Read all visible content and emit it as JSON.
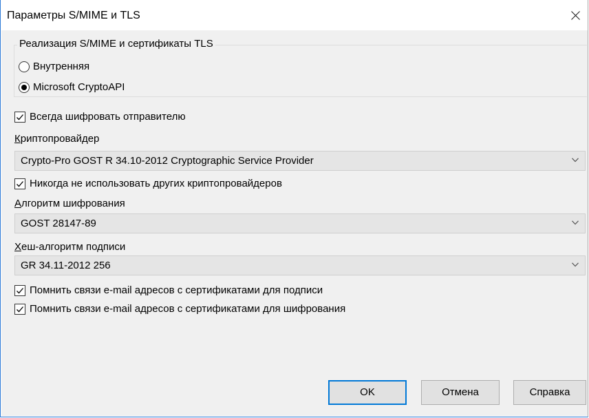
{
  "window": {
    "title": "Параметры S/MIME и TLS"
  },
  "group": {
    "caption": "Реализация S/MIME и сертификаты TLS",
    "options": [
      {
        "label": "Внутренняя",
        "checked": false
      },
      {
        "label": "Microsoft CryptoAPI",
        "checked": true
      }
    ]
  },
  "always_encrypt": {
    "label": "Всегда шифровать отправителю",
    "checked": true
  },
  "provider": {
    "label_mnemonic": "К",
    "label_rest": "риптопровайдер",
    "value": "Crypto-Pro GOST R 34.10-2012 Cryptographic Service Provider"
  },
  "never_other": {
    "label": "Никогда не использовать других криптопровайдеров",
    "checked": true
  },
  "encryption": {
    "label_mnemonic": "А",
    "label_rest": "лгоритм шифрования",
    "value": "GOST 28147-89"
  },
  "hash": {
    "label_mnemonic": "Х",
    "label_rest": "еш-алгоритм подписи",
    "value": "GR 34.11-2012 256"
  },
  "remember_sign": {
    "label": "Помнить связи e-mail адресов с сертификатами для подписи",
    "checked": true
  },
  "remember_encrypt": {
    "label": "Помнить связи e-mail адресов с сертификатами для шифрования",
    "checked": true
  },
  "buttons": {
    "ok": "OK",
    "cancel": "Отмена",
    "help": "Справка"
  },
  "icons": {
    "close": "close-icon",
    "check": "checkmark-icon",
    "dropdown": "chevron-down-icon"
  },
  "colors": {
    "accent": "#0078d7",
    "dialog_bg": "#f0f0f0",
    "combo_bg": "#e5e5e5"
  }
}
